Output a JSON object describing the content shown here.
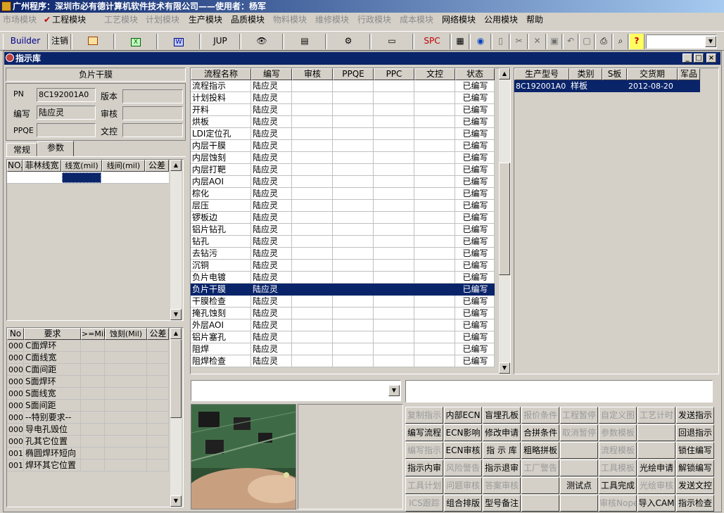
{
  "app_title": "广州程序：深圳市必有德计算机软件技术有限公司——使用者：杨军",
  "menu": [
    {
      "label": "市场模块",
      "enabled": false
    },
    {
      "label": "工程模块",
      "enabled": true,
      "checked": true
    },
    {
      "label": "工艺模块",
      "enabled": false
    },
    {
      "label": "计划模块",
      "enabled": false
    },
    {
      "label": "生产模块",
      "enabled": true
    },
    {
      "label": "品质模块",
      "enabled": true
    },
    {
      "label": "物料模块",
      "enabled": false
    },
    {
      "label": "维修模块",
      "enabled": false
    },
    {
      "label": "行政模块",
      "enabled": false
    },
    {
      "label": "成本模块",
      "enabled": false
    },
    {
      "label": "网络模块",
      "enabled": true
    },
    {
      "label": "公用模块",
      "enabled": true
    },
    {
      "label": "帮助",
      "enabled": true
    }
  ],
  "toolbar": {
    "builder": "Builder",
    "logout": "注销",
    "jup": "JUP",
    "spc": "SPC",
    "icons": [
      "calc-icon",
      "excel-icon",
      "word-icon",
      "eye-icon",
      "database-icon",
      "network-icon",
      "printer-device-icon",
      "spc-icon",
      "save-icon",
      "globe-icon",
      "doc-icon",
      "cut-icon",
      "delete-icon",
      "disk-icon",
      "undo-icon",
      "copy-icon",
      "print-icon",
      "find-icon",
      "help-icon"
    ]
  },
  "window_title": "指示库",
  "left": {
    "heading": "负片干膜",
    "pn_label": "PN",
    "pn": "8C192001A0",
    "version_label": "版本",
    "version": "",
    "writer_label": "编写",
    "writer": "陆应灵",
    "review_label": "审核",
    "review": "",
    "ppqe_label": "PPQE",
    "ppqe": "",
    "control_label": "文控",
    "control": "",
    "tabs": [
      "常规",
      "参数"
    ],
    "param_headers": [
      "NO.",
      "菲林线宽",
      "线宽(mil)",
      "线间(mil)",
      "公差"
    ],
    "req_headers": [
      "No",
      "要求",
      ">=Mil",
      "蚀刻(Mil)",
      "公差"
    ],
    "req_rows": [
      {
        "no": "000",
        "req": "C面焊环"
      },
      {
        "no": "000",
        "req": "C面线宽"
      },
      {
        "no": "000",
        "req": "C面间距"
      },
      {
        "no": "000",
        "req": "S面焊环"
      },
      {
        "no": "000",
        "req": "S面线宽"
      },
      {
        "no": "000",
        "req": "S面间距"
      },
      {
        "no": "000",
        "req": "--特别要求--"
      },
      {
        "no": "000",
        "req": "导电孔毁位"
      },
      {
        "no": "000",
        "req": "孔其它位置"
      },
      {
        "no": "001",
        "req": "椭圆焊环短向"
      },
      {
        "no": "001",
        "req": "焊环其它位置"
      }
    ]
  },
  "flow": {
    "headers": [
      "流程名称",
      "编写",
      "审核",
      "PPQE",
      "PPC",
      "文控",
      "状态"
    ],
    "rows": [
      {
        "name": "流程指示",
        "writer": "陆应灵",
        "status": "已编写"
      },
      {
        "name": "计划投料",
        "writer": "陆应灵",
        "status": "已编写"
      },
      {
        "name": "开料",
        "writer": "陆应灵",
        "status": "已编写"
      },
      {
        "name": "烘板",
        "writer": "陆应灵",
        "status": "已编写"
      },
      {
        "name": "LDI定位孔",
        "writer": "陆应灵",
        "status": "已编写"
      },
      {
        "name": "内层干膜",
        "writer": "陆应灵",
        "status": "已编写"
      },
      {
        "name": "内层蚀刻",
        "writer": "陆应灵",
        "status": "已编写"
      },
      {
        "name": "内层打靶",
        "writer": "陆应灵",
        "status": "已编写"
      },
      {
        "name": "内层AOI",
        "writer": "陆应灵",
        "status": "已编写"
      },
      {
        "name": "棕化",
        "writer": "陆应灵",
        "status": "已编写"
      },
      {
        "name": "层压",
        "writer": "陆应灵",
        "status": "已编写"
      },
      {
        "name": "锣板边",
        "writer": "陆应灵",
        "status": "已编写"
      },
      {
        "name": "铝片钻孔",
        "writer": "陆应灵",
        "status": "已编写"
      },
      {
        "name": "钻孔",
        "writer": "陆应灵",
        "status": "已编写"
      },
      {
        "name": "去钻污",
        "writer": "陆应灵",
        "status": "已编写"
      },
      {
        "name": "沉铜",
        "writer": "陆应灵",
        "status": "已编写"
      },
      {
        "name": "负片电镀",
        "writer": "陆应灵",
        "status": "已编写"
      },
      {
        "name": "负片干膜",
        "writer": "陆应灵",
        "status": "已编写",
        "selected": true
      },
      {
        "name": "干膜检查",
        "writer": "陆应灵",
        "status": "已编写"
      },
      {
        "name": "掩孔蚀刻",
        "writer": "陆应灵",
        "status": "已编写"
      },
      {
        "name": "外层AOI",
        "writer": "陆应灵",
        "status": "已编写"
      },
      {
        "name": "铝片塞孔",
        "writer": "陆应灵",
        "status": "已编写"
      },
      {
        "name": "阻焊",
        "writer": "陆应灵",
        "status": "已编写"
      },
      {
        "name": "阻焊检查",
        "writer": "陆应灵",
        "status": "已编写"
      }
    ]
  },
  "orders": {
    "headers": [
      "生产型号",
      "类别",
      "S板",
      "交货期",
      "军品"
    ],
    "rows": [
      {
        "model": "8C192001A0",
        "type": "样板",
        "s": "",
        "date": "2012-08-20",
        "mil": ""
      }
    ]
  },
  "actions": [
    [
      "复制指示",
      "内部ECN",
      "盲埋孔板",
      "报价条件",
      "工程暂停",
      "自定义图",
      "工艺计时",
      "发送指示"
    ],
    [
      "编写流程",
      "ECN影响",
      "修改申请",
      "合拼条件",
      "取消暂停",
      "参数模板",
      "",
      "回退指示"
    ],
    [
      "编写指示",
      "ECN审核",
      "指 示 库",
      "粗略拼板",
      "",
      "流程模板",
      "",
      "锁住编写"
    ],
    [
      "指示内审",
      "风险警告",
      "指示退审",
      "工厂警告",
      "",
      "工具模板",
      "光绘申请",
      "解锁编写"
    ],
    [
      "工具计划",
      "问题审核",
      "答案审核",
      "",
      "测试点",
      "工具完成",
      "光绘审核",
      "发送文控"
    ],
    [
      "ICS跟踪",
      "组合排版",
      "型号备注",
      "",
      "",
      "审核Nope",
      "导入CAM",
      "指示检查"
    ]
  ],
  "actions_disabled": [
    [
      true,
      false,
      false,
      true,
      true,
      true,
      true,
      false
    ],
    [
      false,
      false,
      false,
      false,
      true,
      true,
      false,
      false
    ],
    [
      true,
      false,
      false,
      false,
      false,
      true,
      false,
      false
    ],
    [
      false,
      true,
      false,
      true,
      false,
      true,
      false,
      false
    ],
    [
      true,
      true,
      true,
      false,
      false,
      false,
      true,
      false
    ],
    [
      true,
      false,
      false,
      false,
      false,
      true,
      false,
      false
    ]
  ]
}
